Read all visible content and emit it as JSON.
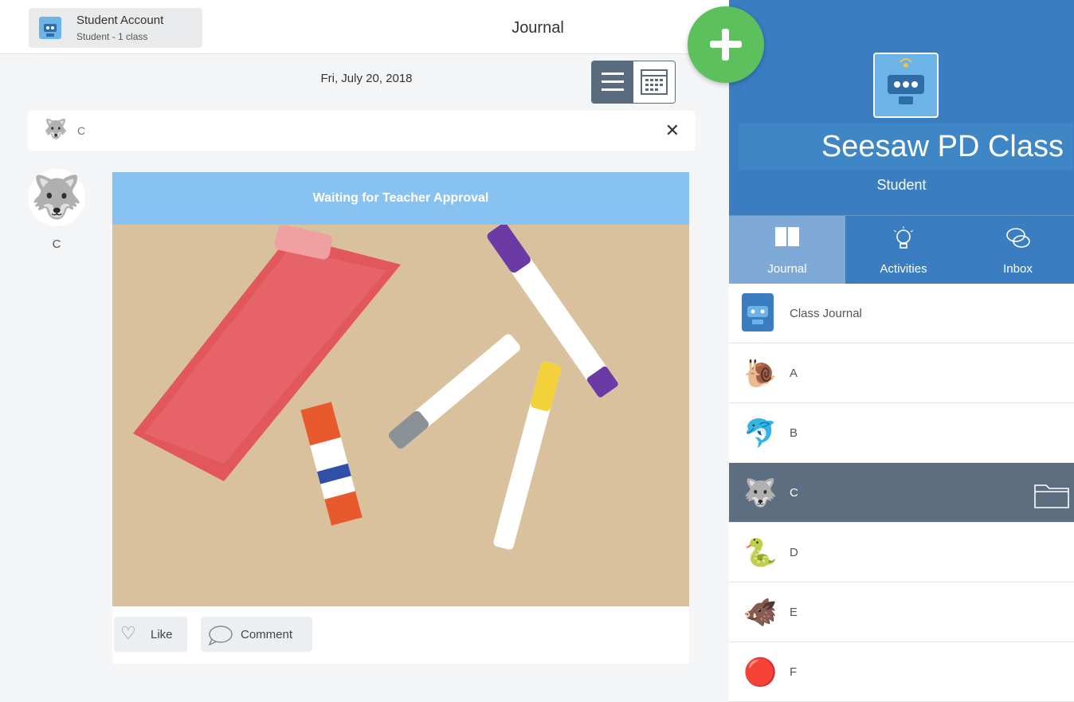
{
  "header": {
    "account_name": "Student Account",
    "account_sub": "Student - 1 class",
    "title": "Journal"
  },
  "journal": {
    "date": "Fri, July 20, 2018",
    "filter_label": "C",
    "filter_emoji": "🐺",
    "post": {
      "author": "C",
      "author_emoji": "🐺",
      "status_banner": "Waiting for Teacher Approval",
      "like_label": "Like",
      "comment_label": "Comment"
    }
  },
  "sidebar": {
    "class_name": "Seesaw PD Class",
    "role": "Student",
    "tabs": [
      {
        "label": "Journal",
        "icon": "book-icon"
      },
      {
        "label": "Activities",
        "icon": "lightbulb-icon"
      },
      {
        "label": "Inbox",
        "icon": "chat-bubbles-icon"
      }
    ],
    "items": [
      {
        "label": "Class Journal",
        "icon": "robot-icon"
      },
      {
        "label": "A",
        "emoji": "🐌"
      },
      {
        "label": "B",
        "emoji": "🐬"
      },
      {
        "label": "C",
        "emoji": "🐺"
      },
      {
        "label": "D",
        "emoji": "🐍"
      },
      {
        "label": "E",
        "emoji": "🐗"
      },
      {
        "label": "F",
        "emoji": "🔴"
      }
    ]
  },
  "colors": {
    "class_blue": "#3a7dc0",
    "add_green": "#5cc15d",
    "banner_blue": "#88c2f0",
    "selected_row": "#5d6e80"
  }
}
